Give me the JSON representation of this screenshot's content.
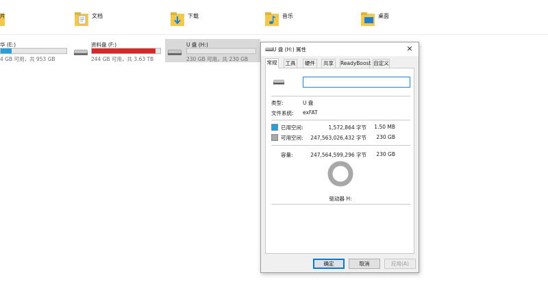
{
  "folders": [
    {
      "label": "片",
      "icon": "pictures-folder-icon"
    },
    {
      "label": "文档",
      "icon": "documents-folder-icon"
    },
    {
      "label": "下载",
      "icon": "downloads-folder-icon"
    },
    {
      "label": "音乐",
      "icon": "music-folder-icon"
    },
    {
      "label": "桌面",
      "icon": "desktop-folder-icon"
    }
  ],
  "drives": [
    {
      "name": "华 (E:)",
      "size": "4 GB 可用，共 953 GB",
      "used_fraction": 0.17,
      "bar_color": "#26a0da"
    },
    {
      "name": "资料盘 (F:)",
      "size": "244 GB 可用，共 3.63 TB",
      "used_fraction": 0.93,
      "bar_color": "#da2626"
    },
    {
      "name": "U 盘 (H:)",
      "size": "230 GB 可用，共 230 GB",
      "used_fraction": 0.0,
      "bar_color": "#26a0da"
    }
  ],
  "dialog": {
    "title": "U 盘 (H:) 属性",
    "close_glyph": "✕",
    "tabs": [
      "常规",
      "工具",
      "硬件",
      "共享",
      "ReadyBoost",
      "自定义"
    ],
    "active_tab": 0,
    "name_value": "",
    "type_label": "类型:",
    "type_value": "U 盘",
    "fs_label": "文件系统:",
    "fs_value": "exFAT",
    "used_label": "已用空间:",
    "used_bytes": "1,572,864 字节",
    "used_size": "1.50 MB",
    "used_color": "#26a0da",
    "free_label": "可用空间:",
    "free_bytes": "247,563,026,432 字节",
    "free_size": "230 GB",
    "free_color": "#a8a8a8",
    "capacity_label": "容量:",
    "capacity_bytes": "247,564,599,296 字节",
    "capacity_size": "230 GB",
    "drive_label": "驱动器 H:",
    "ok_label": "确定",
    "cancel_label": "取消",
    "apply_label": "应用(A)"
  }
}
